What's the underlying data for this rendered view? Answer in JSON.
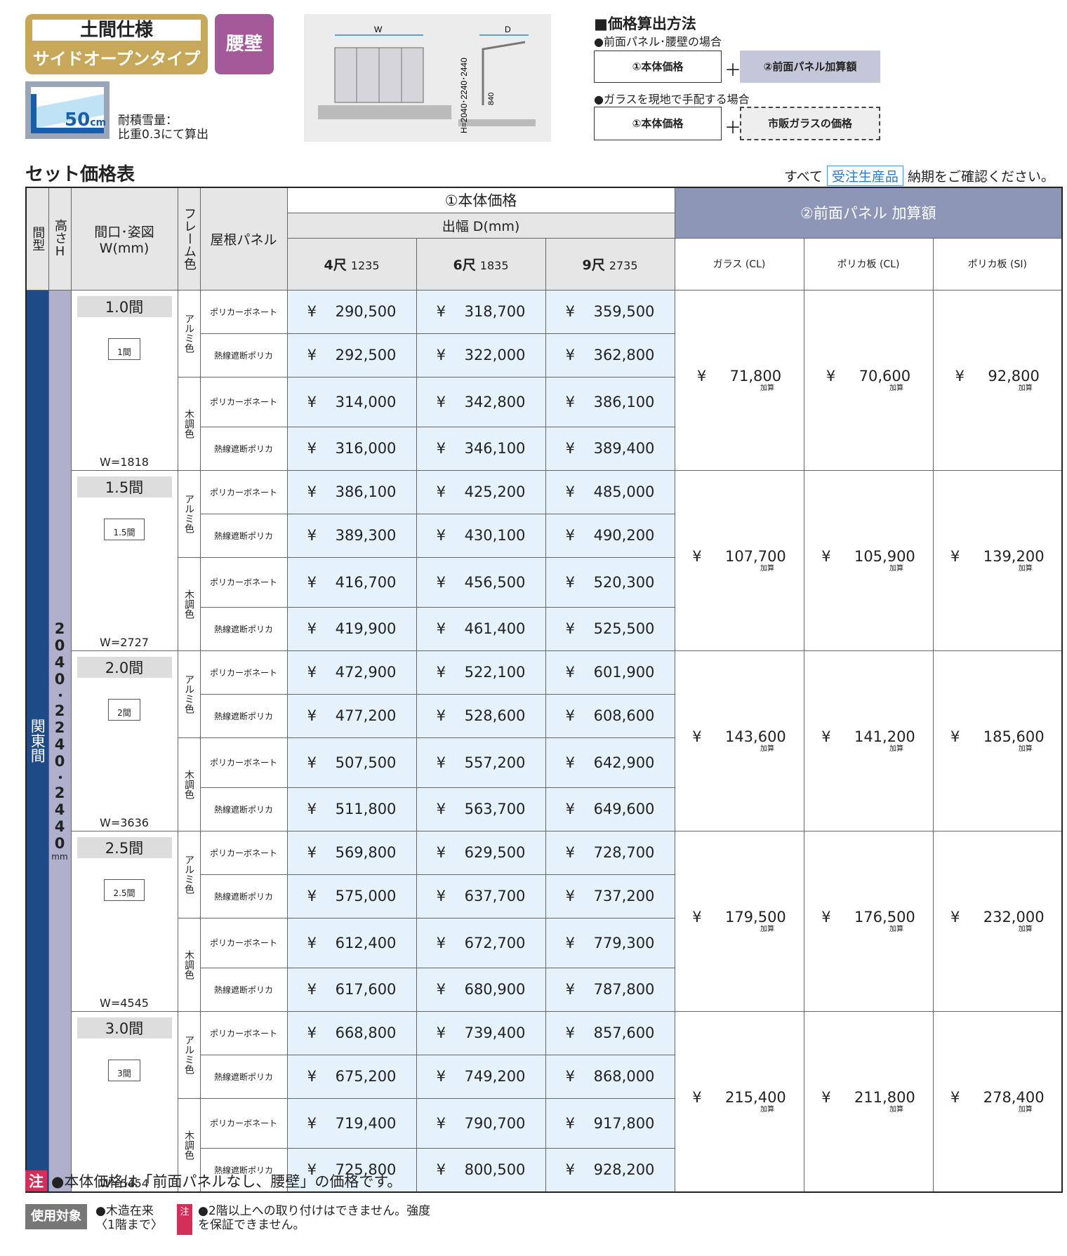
{
  "header": {
    "badge_line1": "土間仕様",
    "badge_line2": "サイドオープンタイプ",
    "wall_badge": "腰壁",
    "snow_amount": "50",
    "snow_unit": "cm",
    "snow_note_1": "耐積雪量：",
    "snow_note_2": "比重0.3にて算出",
    "diagram_w": "W",
    "diagram_d": "D",
    "diagram_h": "H=2040･2240･2440",
    "diagram_840": "840"
  },
  "calc": {
    "title": "■価格算出方法",
    "case1": "●前面パネル･腰壁の場合",
    "case1_a": "①本体価格",
    "case1_b": "②前面パネル加算額",
    "case2": "●ガラスを現地で手配する場合",
    "case2_a": "①本体価格",
    "case2_b": "市販ガラスの価格",
    "plus": "＋"
  },
  "section": {
    "title": "セット価格表",
    "note_prefix": "すべて",
    "note_tag": "受注生産品",
    "note_suffix": "納期をご確認ください。"
  },
  "table": {
    "h_type": "間型",
    "h_height": "高さH",
    "h_width": "間口･姿図 W(mm)",
    "h_frame": "フレーム色",
    "h_roof": "屋根パネル",
    "h_body": "①本体価格",
    "h_depth": "出幅 D(mm)",
    "cols": [
      "4尺",
      "6尺",
      "9尺"
    ],
    "col_mm": [
      "1235",
      "1835",
      "2735"
    ],
    "h_front": "②前面パネル 加算額",
    "front_cols": [
      "ガラス (CL)",
      "ポリカ板 (CL)",
      "ポリカ板 (SI)"
    ],
    "type_label": "関東間",
    "height_label": "2040･2240･2440",
    "height_unit": "mm",
    "frame_alumi": "アルミ色",
    "frame_wood": "木調色",
    "roof_poly": "ポリカーボネート",
    "roof_heat": "熱線遮断ポリカ",
    "yen": "¥",
    "kasan": "加算",
    "groups": [
      {
        "label": "1.0間",
        "mark": "1間",
        "w": "W=1818",
        "rows": [
          [
            "290,500",
            "318,700",
            "359,500"
          ],
          [
            "292,500",
            "322,000",
            "362,800"
          ],
          [
            "314,000",
            "342,800",
            "386,100"
          ],
          [
            "316,000",
            "346,100",
            "389,400"
          ]
        ],
        "front": [
          "71,800",
          "70,600",
          "92,800"
        ]
      },
      {
        "label": "1.5間",
        "mark": "1.5間",
        "w": "W=2727",
        "rows": [
          [
            "386,100",
            "425,200",
            "485,000"
          ],
          [
            "389,300",
            "430,100",
            "490,200"
          ],
          [
            "416,700",
            "456,500",
            "520,300"
          ],
          [
            "419,900",
            "461,400",
            "525,500"
          ]
        ],
        "front": [
          "107,700",
          "105,900",
          "139,200"
        ]
      },
      {
        "label": "2.0間",
        "mark": "2間",
        "w": "W=3636",
        "rows": [
          [
            "472,900",
            "522,100",
            "601,900"
          ],
          [
            "477,200",
            "528,600",
            "608,600"
          ],
          [
            "507,500",
            "557,200",
            "642,900"
          ],
          [
            "511,800",
            "563,700",
            "649,600"
          ]
        ],
        "front": [
          "143,600",
          "141,200",
          "185,600"
        ]
      },
      {
        "label": "2.5間",
        "mark": "2.5間",
        "w": "W=4545",
        "rows": [
          [
            "569,800",
            "629,500",
            "728,700"
          ],
          [
            "575,000",
            "637,700",
            "737,200"
          ],
          [
            "612,400",
            "672,700",
            "779,300"
          ],
          [
            "617,600",
            "680,900",
            "787,800"
          ]
        ],
        "front": [
          "179,500",
          "176,500",
          "232,000"
        ]
      },
      {
        "label": "3.0間",
        "mark": "3間",
        "w": "W=5454",
        "rows": [
          [
            "668,800",
            "739,400",
            "857,600"
          ],
          [
            "675,200",
            "749,200",
            "868,000"
          ],
          [
            "719,400",
            "790,700",
            "917,800"
          ],
          [
            "725,800",
            "800,500",
            "928,200"
          ]
        ],
        "front": [
          "215,400",
          "211,800",
          "278,400"
        ]
      }
    ]
  },
  "notes": {
    "note_tag": "注",
    "note1": "●本体価格は「前面パネルなし、腰壁」の価格です。",
    "use_tag": "使用対象",
    "use_text": "●木造在来 〈1階まで〉",
    "use_note_tag": "注",
    "use_note": "●2階以上への取り付けはできません。強度を保証できません。"
  }
}
